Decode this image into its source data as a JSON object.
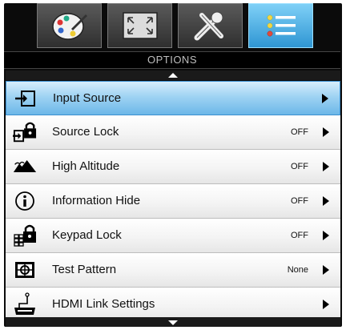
{
  "tabs": [
    {
      "name": "image-settings",
      "icon": "palette-icon"
    },
    {
      "name": "display",
      "icon": "fullscreen-icon"
    },
    {
      "name": "setup",
      "icon": "tools-icon"
    },
    {
      "name": "options",
      "icon": "list-icon",
      "active": true
    }
  ],
  "title": "OPTIONS",
  "rows": [
    {
      "label": "Input Source",
      "value": "",
      "icon": "input-source-icon",
      "selected": true
    },
    {
      "label": "Source Lock",
      "value": "OFF",
      "icon": "source-lock-icon"
    },
    {
      "label": "High Altitude",
      "value": "OFF",
      "icon": "mountain-icon"
    },
    {
      "label": "Information Hide",
      "value": "OFF",
      "icon": "info-icon"
    },
    {
      "label": "Keypad Lock",
      "value": "OFF",
      "icon": "keypad-lock-icon"
    },
    {
      "label": "Test Pattern",
      "value": "None",
      "icon": "test-pattern-icon"
    },
    {
      "label": "HDMI Link Settings",
      "value": "",
      "icon": "hdmi-icon"
    }
  ],
  "colors": {
    "accent": "#2f96d3",
    "selected_row": "#9fd3f3"
  }
}
